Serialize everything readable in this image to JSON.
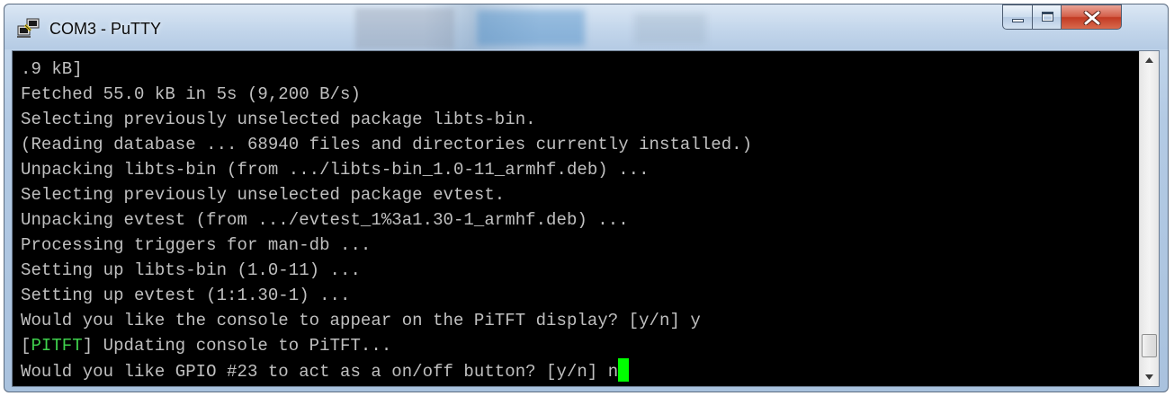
{
  "window": {
    "title": "COM3 - PuTTY",
    "app_icon": "putty-icon"
  },
  "controls": {
    "minimize_icon": "minimize-icon",
    "maximize_icon": "maximize-icon",
    "close_icon": "close-icon"
  },
  "terminal": {
    "lines": [
      ".9 kB]",
      "Fetched 55.0 kB in 5s (9,200 B/s)",
      "Selecting previously unselected package libts-bin.",
      "(Reading database ... 68940 files and directories currently installed.)",
      "Unpacking libts-bin (from .../libts-bin_1.0-11_armhf.deb) ...",
      "Selecting previously unselected package evtest.",
      "Unpacking evtest (from .../evtest_1%3a1.30-1_armhf.deb) ...",
      "Processing triggers for man-db ...",
      "Setting up libts-bin (1.0-11) ...",
      "Setting up evtest (1:1.30-1) ...",
      "Would you like the console to appear on the PiTFT display? [y/n] y"
    ],
    "pitft_line": {
      "open_bracket": "[",
      "tag": "PITFT",
      "rest": "] Updating console to PiTFT..."
    },
    "prompt_line": "Would you like GPIO #23 to act as a on/off button? [y/n] n",
    "colors": {
      "background": "#000000",
      "text": "#c0c0c0",
      "tag": "#3fd14d",
      "cursor": "#00ff00"
    }
  },
  "scrollbar": {
    "up_icon": "scroll-up-arrow-icon",
    "down_icon": "scroll-down-arrow-icon",
    "position": 1.0
  }
}
